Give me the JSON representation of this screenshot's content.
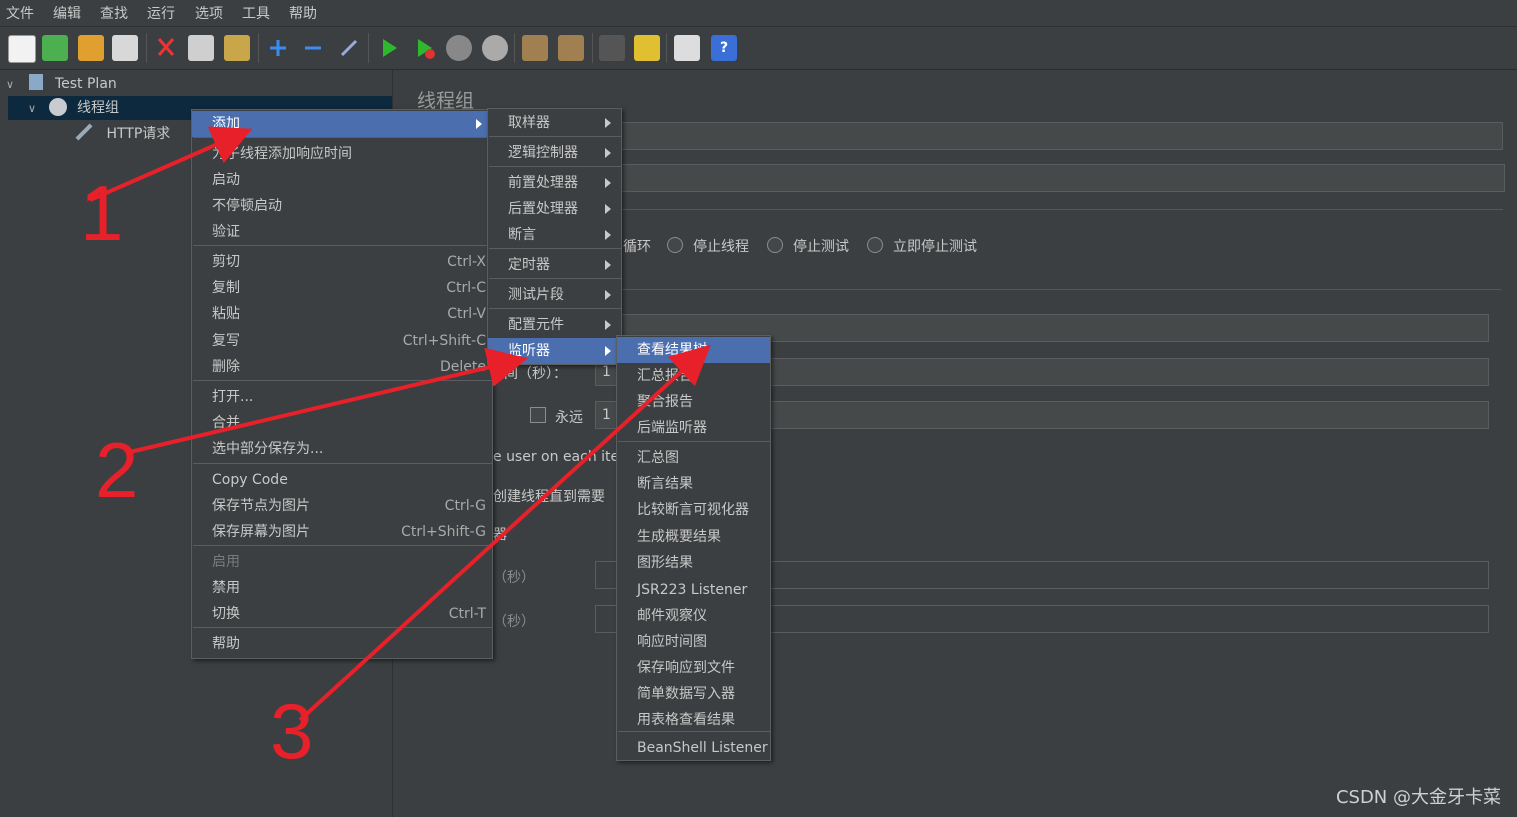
{
  "menubar": [
    "文件",
    "编辑",
    "查找",
    "运行",
    "选项",
    "工具",
    "帮助"
  ],
  "tree": {
    "root": "Test Plan",
    "thread_group": "线程组",
    "http_request": "HTTP请求"
  },
  "panel": {
    "title": "线程组",
    "loop_suffix": "循环",
    "radio_stop_thread": "停止线程",
    "radio_stop_test": "停止测试",
    "radio_stop_now": "立即停止测试",
    "ramp_label": "时间（秒）：",
    "ramp_value": "1",
    "forever_label": "永远",
    "loop_value": "1",
    "same_user": "e user on each itera",
    "delay_create": "创建线程直到需要",
    "scheduler": "器",
    "duration_label": "（秒）",
    "delay_label": "（秒）"
  },
  "context_menu": {
    "items": [
      {
        "label": "添加",
        "submenu": true,
        "selected": true
      },
      {
        "label": "为子线程添加响应时间"
      },
      {
        "label": "启动"
      },
      {
        "label": "不停顿启动"
      },
      {
        "label": "验证"
      },
      {
        "label": "剪切",
        "shortcut": "Ctrl-X"
      },
      {
        "label": "复制",
        "shortcut": "Ctrl-C"
      },
      {
        "label": "粘贴",
        "shortcut": "Ctrl-V"
      },
      {
        "label": "复写",
        "shortcut": "Ctrl+Shift-C"
      },
      {
        "label": "删除",
        "shortcut": "Delete"
      },
      {
        "label": "打开..."
      },
      {
        "label": "合并"
      },
      {
        "label": "选中部分保存为..."
      },
      {
        "label": "Copy Code"
      },
      {
        "label": "保存节点为图片",
        "shortcut": "Ctrl-G"
      },
      {
        "label": "保存屏幕为图片",
        "shortcut": "Ctrl+Shift-G"
      },
      {
        "label": "启用",
        "disabled": true
      },
      {
        "label": "禁用"
      },
      {
        "label": "切换",
        "shortcut": "Ctrl-T"
      },
      {
        "label": "帮助"
      }
    ]
  },
  "add_submenu": {
    "items": [
      {
        "label": "取样器"
      },
      {
        "label": "逻辑控制器"
      },
      {
        "label": "前置处理器"
      },
      {
        "label": "后置处理器"
      },
      {
        "label": "断言"
      },
      {
        "label": "定时器"
      },
      {
        "label": "测试片段"
      },
      {
        "label": "配置元件"
      },
      {
        "label": "监听器",
        "selected": true
      }
    ]
  },
  "listener_submenu": {
    "items": [
      {
        "label": "查看结果树",
        "selected": true
      },
      {
        "label": "汇总报告"
      },
      {
        "label": "聚合报告"
      },
      {
        "label": "后端监听器"
      },
      {
        "label": "汇总图"
      },
      {
        "label": "断言结果"
      },
      {
        "label": "比较断言可视化器"
      },
      {
        "label": "生成概要结果"
      },
      {
        "label": "图形结果"
      },
      {
        "label": "JSR223 Listener"
      },
      {
        "label": "邮件观察仪"
      },
      {
        "label": "响应时间图"
      },
      {
        "label": "保存响应到文件"
      },
      {
        "label": "简单数据写入器"
      },
      {
        "label": "用表格查看结果"
      },
      {
        "label": "BeanShell Listener"
      }
    ]
  },
  "annotations": {
    "n1": "1",
    "n2": "2",
    "n3": "3",
    "color": "#e8202a"
  },
  "watermark": "CSDN @大金牙卡菜"
}
